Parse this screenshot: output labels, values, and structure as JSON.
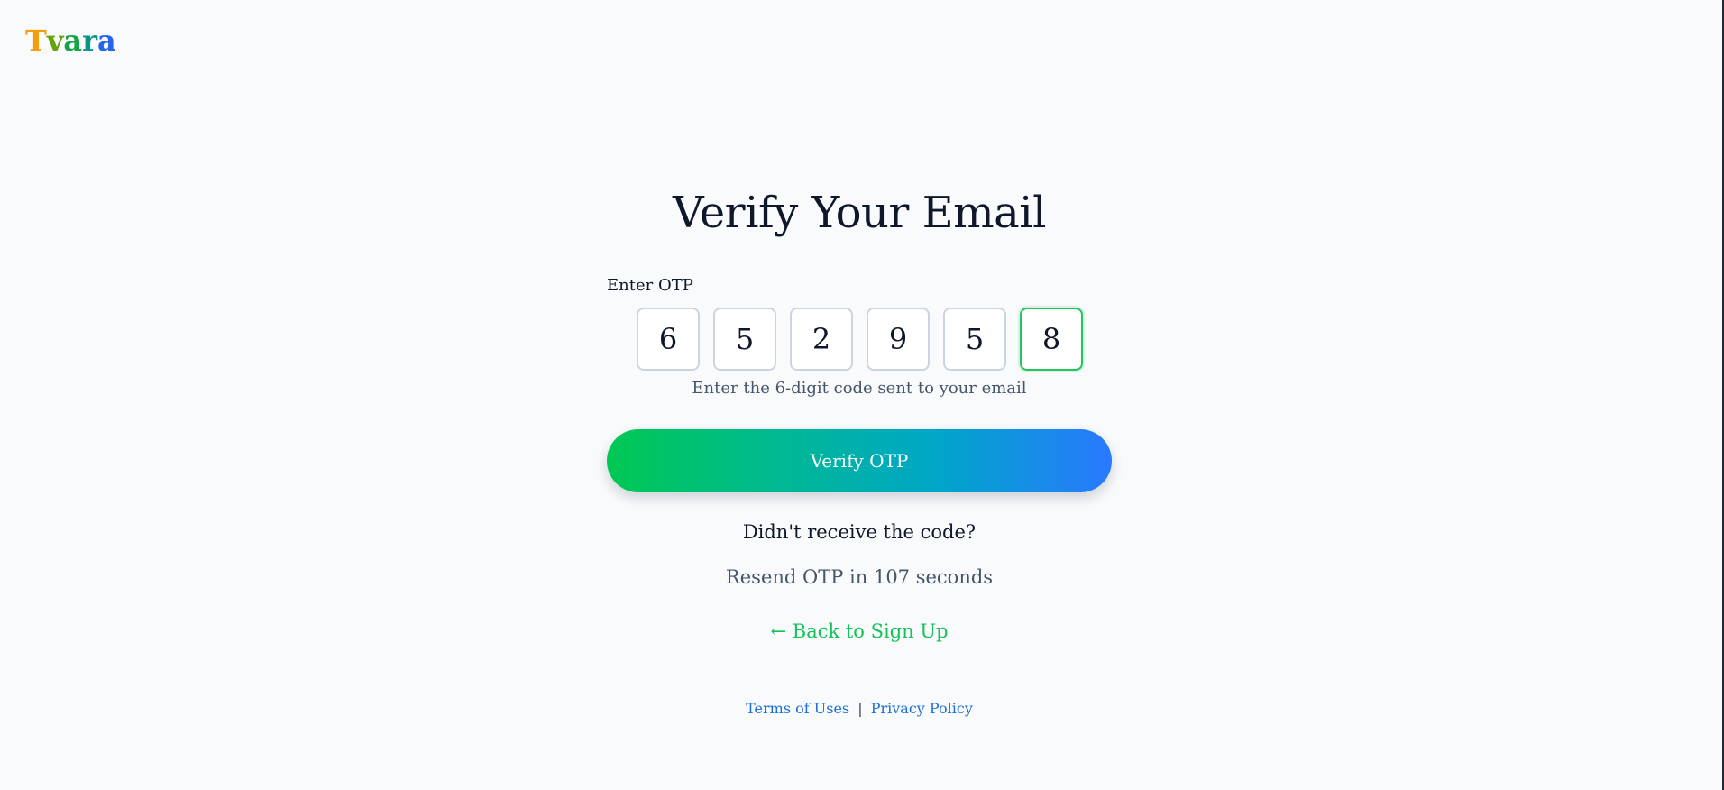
{
  "brand": {
    "letters": [
      {
        "char": "T",
        "color": "#f59e0b"
      },
      {
        "char": "v",
        "color": "#65a30d"
      },
      {
        "char": "a",
        "color": "#16a34a"
      },
      {
        "char": "r",
        "color": "#0d9488"
      },
      {
        "char": "a",
        "color": "#2563eb"
      }
    ]
  },
  "page": {
    "title": "Verify Your Email",
    "otp_label": "Enter OTP",
    "otp_digits": [
      "6",
      "5",
      "2",
      "9",
      "5",
      "8"
    ],
    "active_index": 5,
    "hint": "Enter the 6-digit code sent to your email",
    "verify_label": "Verify OTP",
    "didnt_receive": "Didn't receive the code?",
    "resend_text": "Resend OTP in 107 seconds",
    "back_link": "← Back to Sign Up"
  },
  "footer": {
    "terms": "Terms of Uses",
    "separator": "|",
    "privacy": "Privacy Policy"
  },
  "colors": {
    "accent_green": "#22c55e",
    "gradient_start": "#00c853",
    "gradient_end": "#2979ff",
    "link_blue": "#1d6fd6"
  }
}
